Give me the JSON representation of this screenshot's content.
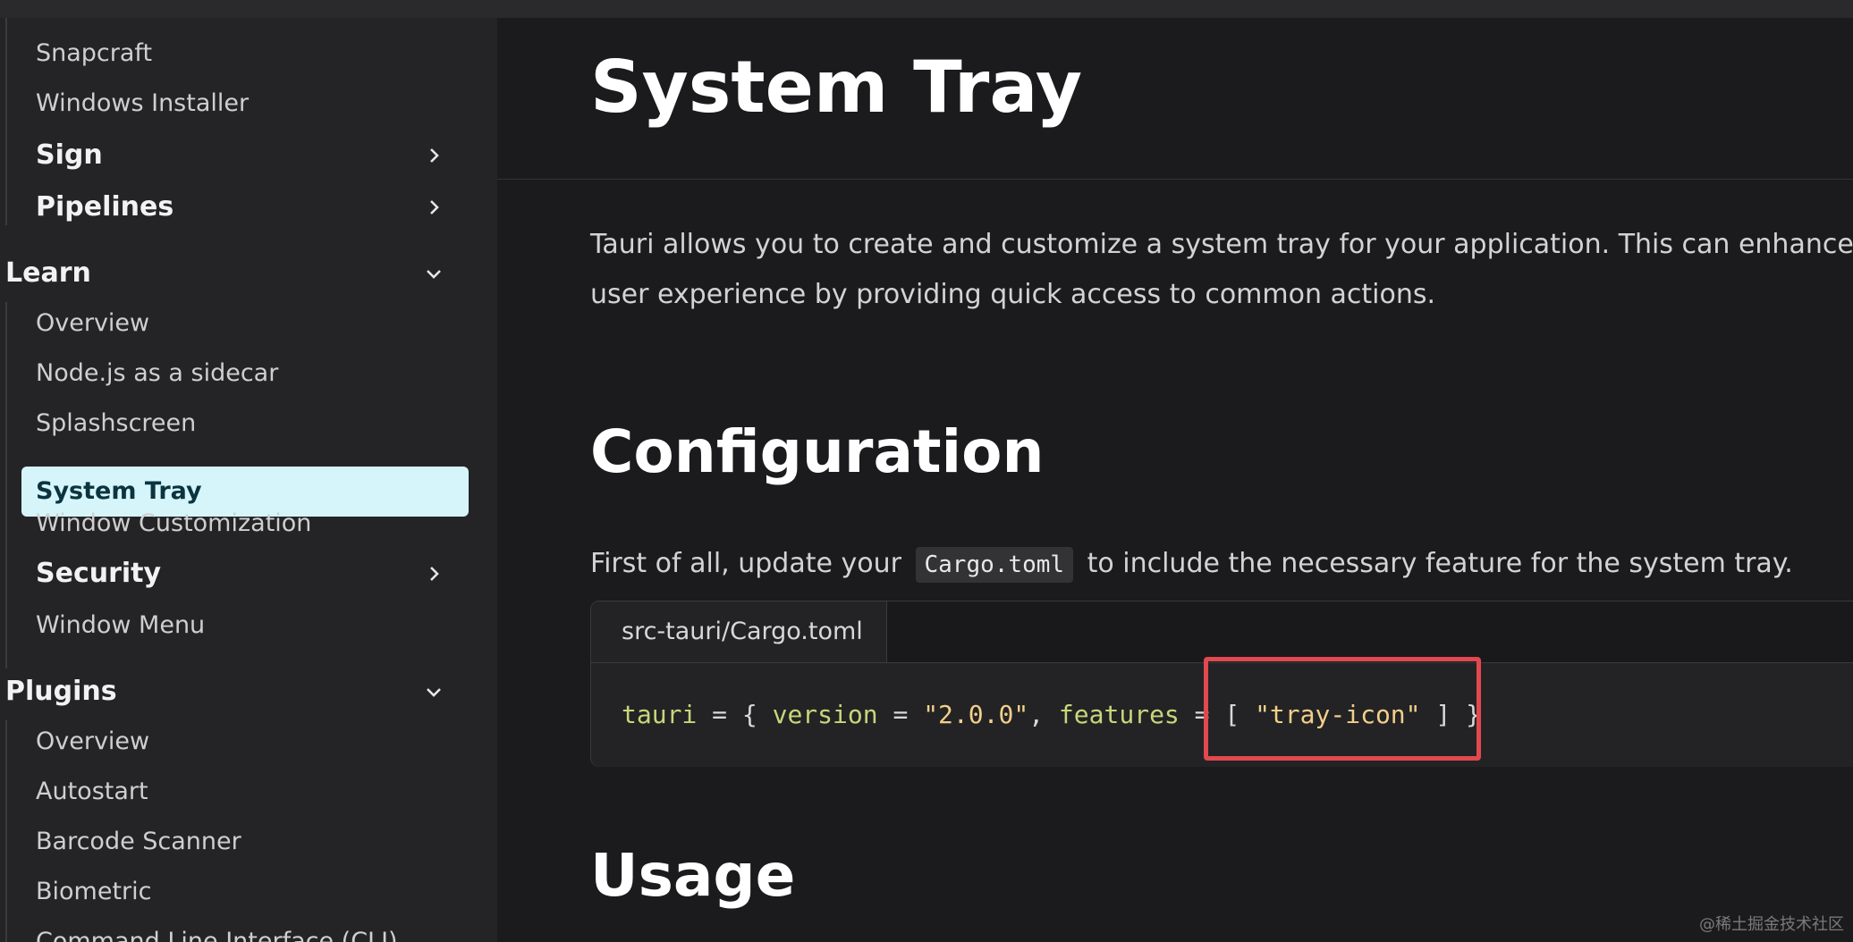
{
  "sidebar": {
    "top_items": [
      "Snapcraft",
      "Windows Installer"
    ],
    "groups_top": [
      "Sign",
      "Pipelines"
    ],
    "learn": {
      "label": "Learn",
      "items": [
        "Overview",
        "Node.js as a sidecar",
        "Splashscreen"
      ],
      "active": "System Tray",
      "items_after": [
        "Window Customization"
      ],
      "security_label": "Security",
      "menu_item": "Window Menu"
    },
    "plugins": {
      "label": "Plugins",
      "items": [
        "Overview",
        "Autostart",
        "Barcode Scanner",
        "Biometric",
        "Command Line Interface (CLI)"
      ]
    }
  },
  "main": {
    "title": "System Tray",
    "intro_line1": "Tauri allows you to create and customize a system tray for your application. This can enhance the",
    "intro_line2": "user experience by providing quick access to common actions.",
    "config_heading": "Configuration",
    "config_text_before": "First of all, update your",
    "config_code": "Cargo.toml",
    "config_text_after": "to include the necessary feature for the system tray.",
    "code_block": {
      "filename": "src-tauri/Cargo.toml",
      "tokens": {
        "t1": "tauri",
        "t2": " = { ",
        "t3": "version",
        "t4": " = ",
        "t5": "\"2.0.0\"",
        "t6": ", ",
        "t7": "features",
        "t8": " = [ ",
        "t9": "\"tray-icon\"",
        "t10": " ] }"
      }
    },
    "usage_heading": "Usage"
  },
  "watermark": "@稀土掘金技术社区",
  "colors": {
    "accent_active_bg": "#d6f5fb",
    "highlight_box": "#e2484f"
  }
}
